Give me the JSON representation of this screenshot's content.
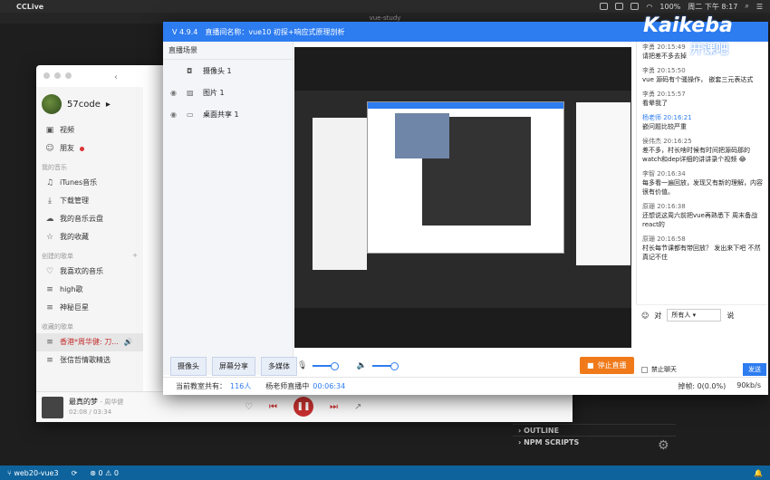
{
  "menubar": {
    "app": "CCLive",
    "battery": "100%",
    "clock": "周二 下午 8:17"
  },
  "vscode": {
    "window_title": "vue-study",
    "panels": [
      "OUTLINE",
      "NPM SCRIPTS"
    ],
    "status": {
      "branch": "web20-vue3",
      "problems": "⊗ 0 ⚠ 0"
    }
  },
  "music": {
    "user": "57code",
    "nav": [
      {
        "label": "视频",
        "icon": "video-icon"
      },
      {
        "label": "朋友",
        "icon": "friends-icon"
      }
    ],
    "my_music_title": "我的音乐",
    "my_music": [
      {
        "label": "iTunes音乐",
        "icon": "music-icon"
      },
      {
        "label": "下载管理",
        "icon": "download-icon"
      },
      {
        "label": "我的音乐云盘",
        "icon": "cloud-icon"
      },
      {
        "label": "我的收藏",
        "icon": "star-icon"
      }
    ],
    "created_title": "创建的歌单",
    "created": [
      {
        "label": "我喜欢的音乐",
        "icon": "heart-icon"
      },
      {
        "label": "high歌",
        "icon": "playlist-icon"
      },
      {
        "label": "神秘巨星",
        "icon": "playlist-icon"
      }
    ],
    "fav_title": "收藏的歌单",
    "favs": [
      {
        "label": "香港*周华健: 刀...",
        "icon": "playlist-icon"
      },
      {
        "label": "张信哲情歌精选",
        "icon": "playlist-icon"
      }
    ],
    "player": {
      "title": "最真的梦",
      "artist": "- 周华健",
      "time": "02:08 / 03:34"
    }
  },
  "live": {
    "version": "V 4.9.4",
    "room": "直播间名称：vue10 初探+响应式原理剖析",
    "scene_title": "直播场景",
    "scenes": [
      {
        "label": "摄像头 1",
        "icon": "camera-icon"
      },
      {
        "label": "图片 1",
        "icon": "image-icon"
      },
      {
        "label": "桌面共享 1",
        "icon": "desktop-icon"
      }
    ],
    "tools": [
      "摄像头",
      "屏幕分享",
      "多媒体"
    ],
    "stop_label": "停止直播",
    "footer": {
      "count_label": "当前教室共有：",
      "count": "116人",
      "live_label": "杨老师直播中",
      "duration": "00:06:34",
      "loss": "掉帧: 0(0.0%)",
      "rate": "90kb/s"
    }
  },
  "chat": {
    "messages": [
      {
        "who": "李勇 20:15:49",
        "text": "请把差不多去掉",
        "teacher": false
      },
      {
        "who": "李勇 20:15:50",
        "text": "vue 源码有个骚操作， 嵌套三元表达式",
        "teacher": false
      },
      {
        "who": "李勇 20:15:57",
        "text": "看晕我了",
        "teacher": false
      },
      {
        "who": "杨老师 20:16:21",
        "text": "嵌问题比较严重",
        "teacher": true
      },
      {
        "who": "侯伟杰 20:16:25",
        "text": "差不多，村长啥时候有时间把源码那的watch和dep详细的讲讲录个视频 😂",
        "teacher": false
      },
      {
        "who": "李智 20:16:34",
        "text": "每多看一遍回放，发现又有新的理解，内容很有价值。",
        "teacher": false
      },
      {
        "who": "原珊 20:16:38",
        "text": "还想说这周六前把vue再熟悉下 周末备战react的",
        "teacher": false
      },
      {
        "who": "原珊 20:16:58",
        "text": "村长每节课都有带回放？ 发出来下吧 不然真记不住",
        "teacher": false
      }
    ],
    "to_label": "对",
    "to_value": "所有人",
    "speak": "说",
    "ban": "禁止聊天",
    "send": "发送"
  },
  "logo": {
    "en": "Kaikeba",
    "cn": "开课吧"
  }
}
